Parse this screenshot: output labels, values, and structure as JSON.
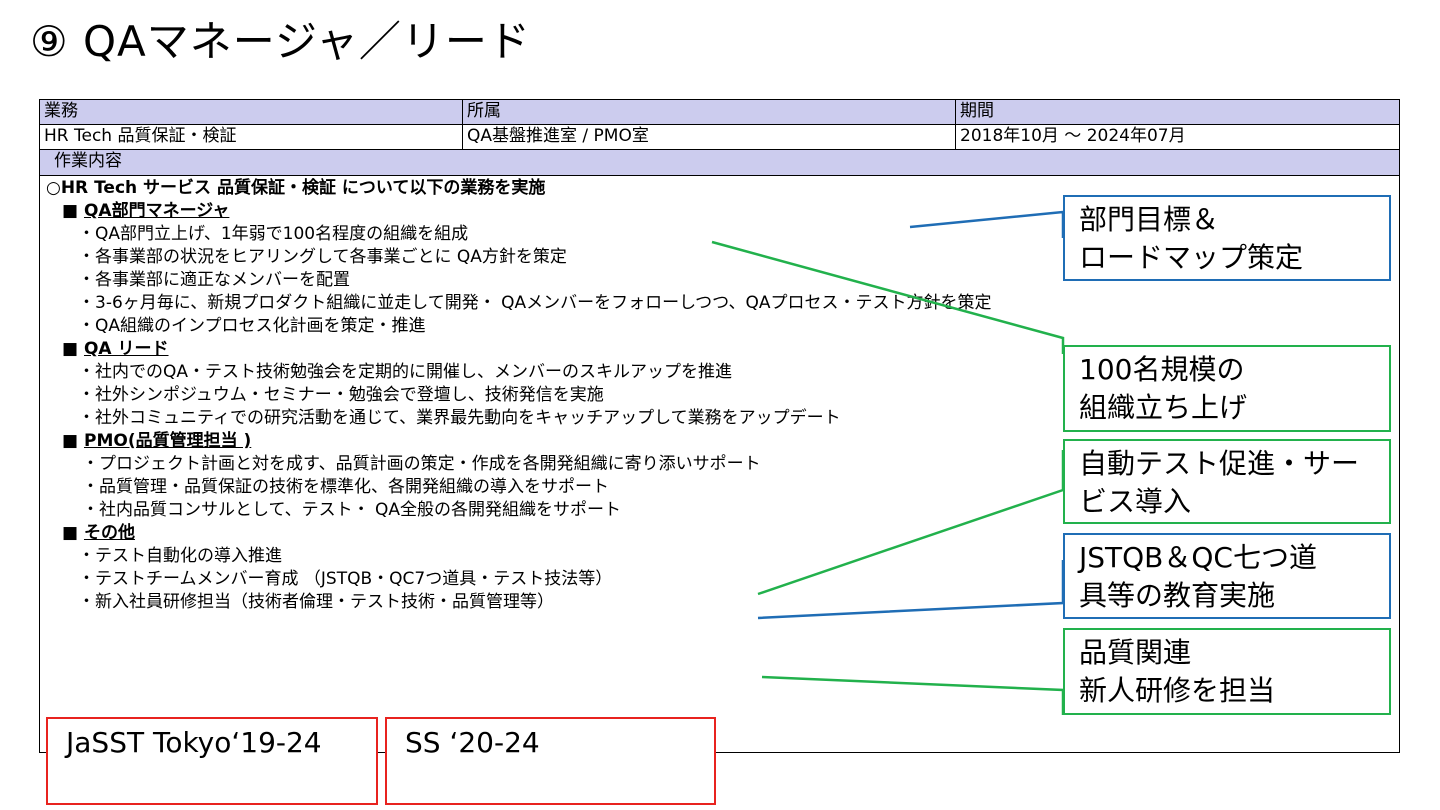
{
  "title": "⑨ QAマネージャ／リード",
  "table": {
    "headers": [
      "業務",
      "所属",
      "期間"
    ],
    "values": [
      "HR Tech 品質保証・検証",
      "QA基盤推進室 / PMO室",
      "2018年10月 ～ 2024年07月"
    ],
    "section_header": "作業内容"
  },
  "content": {
    "lead": "○HR Tech サービス  品質保証・検証  について以下の業務を実施",
    "sections": [
      {
        "marker": "■ ",
        "heading": "QA部門マネージャ",
        "items": [
          "・QA部門立上げ、1年弱で100名程度の組織を組成",
          "・各事業部の状況をヒアリングして各事業ごとに QA方針を策定",
          "・各事業部に適正なメンバーを配置",
          "・3-6ヶ月毎に、新規プロダクト組織に並走して開発・ QAメンバーをフォローしつつ、QAプロセス・テスト方針を策定",
          "・QA組織のインプロセス化計画を策定・推進"
        ]
      },
      {
        "marker": "■ ",
        "heading": "QA リード",
        "items": [
          "・社内でのQA・テスト技術勉強会を定期的に開催し、メンバーのスキルアップを推進",
          "・社外シンポジュウム・セミナー・勉強会で登壇し、技術発信を実施",
          "・社外コミュニティでの研究活動を通じて、業界最先動向をキャッチアップして業務をアップデート"
        ]
      },
      {
        "marker": "■ ",
        "heading": "PMO(品質管理担当 )",
        "items": [
          "・プロジェクト計画と対を成す、品質計画の策定・作成を各開発組織に寄り添いサポート",
          "・品質管理・品質保証の技術を標準化、各開発組織の導入をサポート",
          "・社内品質コンサルとして、テスト・ QA全般の各開発組織をサポート"
        ]
      },
      {
        "marker": "■ ",
        "heading": "その他",
        "items": [
          "・テスト自動化の導入推進",
          "・テストチームメンバー育成 （JSTQB・QC7つ道具・テスト技法等）",
          "・新入社員研修担当（技術者倫理・テスト技術・品質管理等）"
        ]
      }
    ]
  },
  "callouts": [
    {
      "line1": "部門目標＆",
      "line2": "ロードマップ策定",
      "color": "#1f6db5"
    },
    {
      "line1": "100名規模の",
      "line2": "組織立ち上げ",
      "color": "#22b14c"
    },
    {
      "line1": "自動テスト促進・サー",
      "line2": "ビス導入",
      "color": "#22b14c"
    },
    {
      "line1": "JSTQB＆QC七つ道",
      "line2": "具等の教育実施",
      "color": "#1f6db5"
    },
    {
      "line1": "品質関連",
      "line2": "新人研修を担当",
      "color": "#22b14c"
    }
  ],
  "events": [
    "JaSST Tokyo‘19-24",
    "SS ‘20-24"
  ],
  "colors": {
    "header_bg": "#ccccee",
    "blue": "#1f6db5",
    "green": "#22b14c",
    "red": "#e8231f"
  }
}
